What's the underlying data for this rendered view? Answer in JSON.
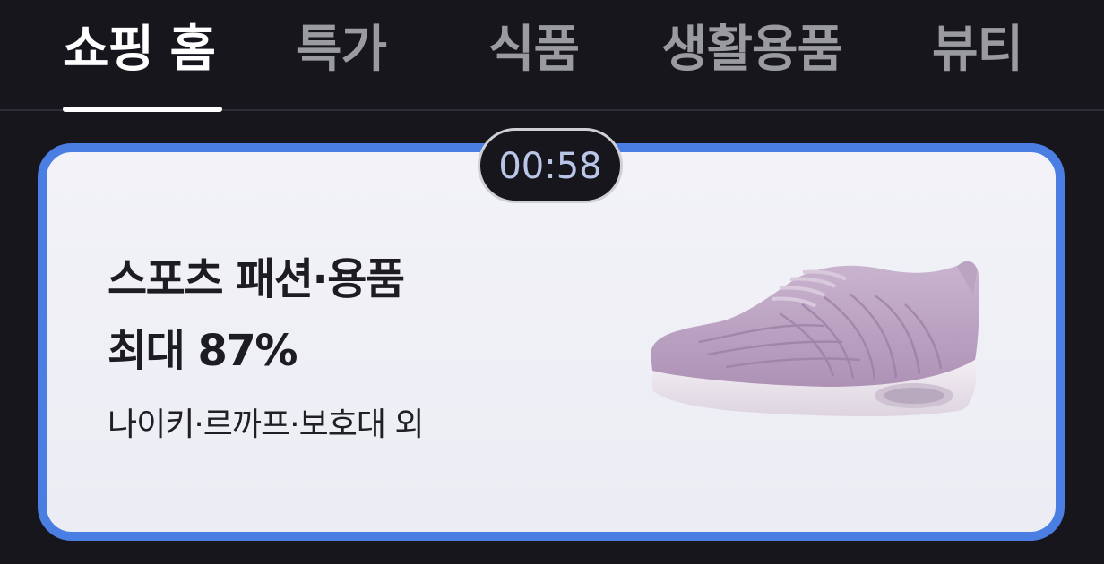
{
  "tabs": [
    {
      "label": "쇼핑 홈",
      "active": true
    },
    {
      "label": "특가",
      "active": false
    },
    {
      "label": "식품",
      "active": false
    },
    {
      "label": "생활용품",
      "active": false
    },
    {
      "label": "뷰티",
      "active": false
    }
  ],
  "card": {
    "timer": "00:58",
    "title": "스포츠 패션·용품",
    "discount": "최대 87%",
    "subtitle": "나이키·르까프·보호대 외",
    "image": "purple-sneaker-image",
    "border_color": "#4a7ee3"
  }
}
